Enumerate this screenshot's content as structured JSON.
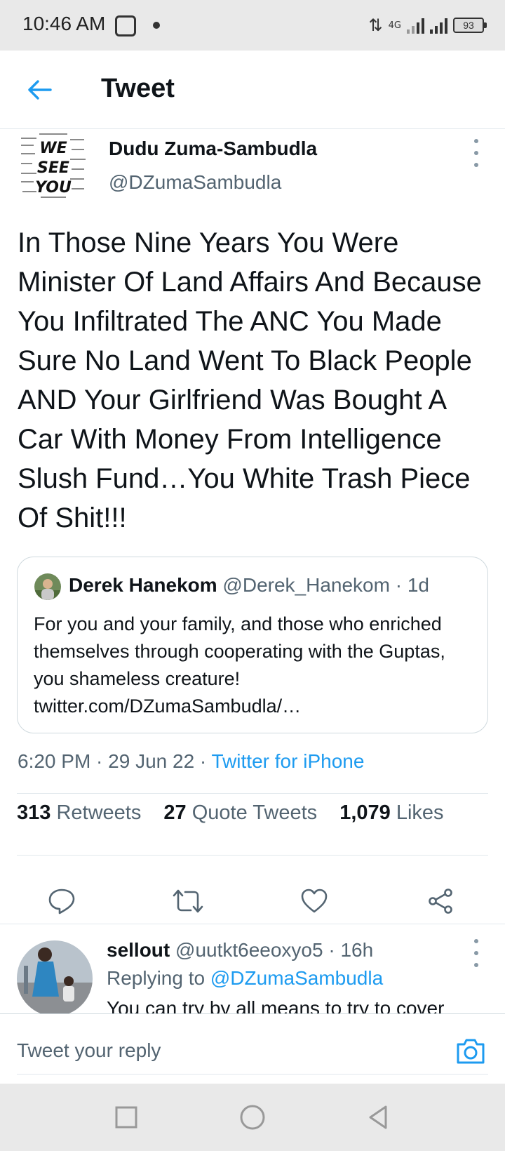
{
  "status_bar": {
    "time": "10:46 AM",
    "network": "4G",
    "battery": "93",
    "icons": [
      "app-notification-icon",
      "data-arrows-icon",
      "signal-4g-icon",
      "signal-icon",
      "battery-icon"
    ]
  },
  "header": {
    "title": "Tweet",
    "back_icon": "arrow-left-icon",
    "accent": "#1d9bf0"
  },
  "tweet": {
    "author_name": "Dudu Zuma-Sambudla",
    "author_handle": "@DZumaSambudla",
    "avatar_lines": [
      "WE",
      "SEE",
      "YOU"
    ],
    "text": "In Those Nine Years You Were Minister Of Land Affairs And Because You Infiltrated The ANC You Made Sure No Land Went To Black People AND Your Girlfriend Was Bought A Car With Money From Intelligence Slush Fund…You White Trash Piece Of Shit!!!",
    "quote": {
      "name": "Derek Hanekom",
      "meta": " @Derek_Hanekom · 1d",
      "text": "For you and your family, and those who enriched themselves through cooperating with the Guptas, you shameless creature! twitter.com/DZumaSambudla/…"
    },
    "timestamp": "6:20 PM · 29 Jun 22 · ",
    "source": "Twitter for iPhone",
    "stats": {
      "retweets_count": "313",
      "retweets_label": " Retweets",
      "quotes_count": "27",
      "quotes_label": " Quote Tweets",
      "likes_count": "1,079",
      "likes_label": " Likes"
    },
    "actions": [
      "reply-icon",
      "retweet-icon",
      "like-icon",
      "share-icon"
    ]
  },
  "reply": {
    "name": "sellout",
    "meta": " @uutkt6eeoxyo5 · 16h",
    "replying_prefix": "Replying to ",
    "replying_to": "@DZumaSambudla",
    "text": "You can try by all means to try to cover"
  },
  "compose": {
    "placeholder": "Tweet your reply",
    "camera_icon": "camera-icon"
  },
  "nav_bar": {
    "buttons": [
      "recents-square-icon",
      "home-circle-icon",
      "back-triangle-icon"
    ]
  }
}
